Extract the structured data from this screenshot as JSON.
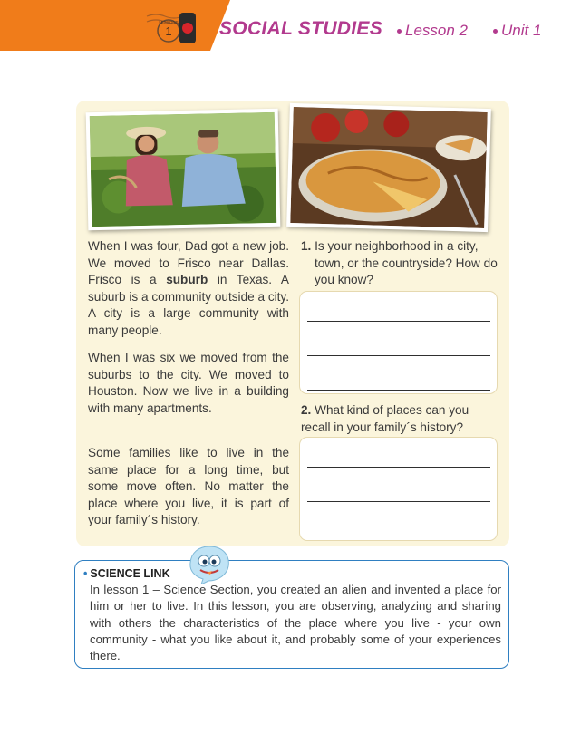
{
  "header": {
    "subject": "SOCIAL STUDIES",
    "lesson": "Lesson 2",
    "unit": "Unit 1",
    "stamp_text": "LESSONS",
    "stamp_number": "1",
    "accent_color": "#f07c1a",
    "title_color": "#b23a8e"
  },
  "story": {
    "p1_before": "When I was four, Dad got a new job. We moved to Frisco near Dallas. Frisco is a ",
    "p1_bold": "suburb",
    "p1_after": " in Texas. A suburb is a community outside a city. A city is a large community with many people.",
    "p2": "When I was six we moved from the suburbs to the city. We moved to Houston. Now we live in a building with many apartments.",
    "p3": "Some families like to live in the same place for a long time, but some move often. No matter the place where you live, it is part of your family´s history."
  },
  "questions": [
    {
      "number": "1.",
      "first": "Is your neighborhood in a city,",
      "rest": "town, or the countryside? How do you know?"
    },
    {
      "number": "2.",
      "first": "What kind of places can you",
      "rest": "recall in your family´s history?"
    }
  ],
  "science_link": {
    "title": "SCIENCE LINK",
    "text": "In lesson 1 – Science Section, you created an alien and invented a place for him or her to live. In this lesson, you are observing, analyzing and sharing with others the characteristics of the place where you live - your own community - what you like about it, and probably some of your experiences there.",
    "border_color": "#2f7fc1"
  },
  "images": {
    "photo1": "gardening-couple-photo",
    "photo2": "apple-pie-photo"
  }
}
